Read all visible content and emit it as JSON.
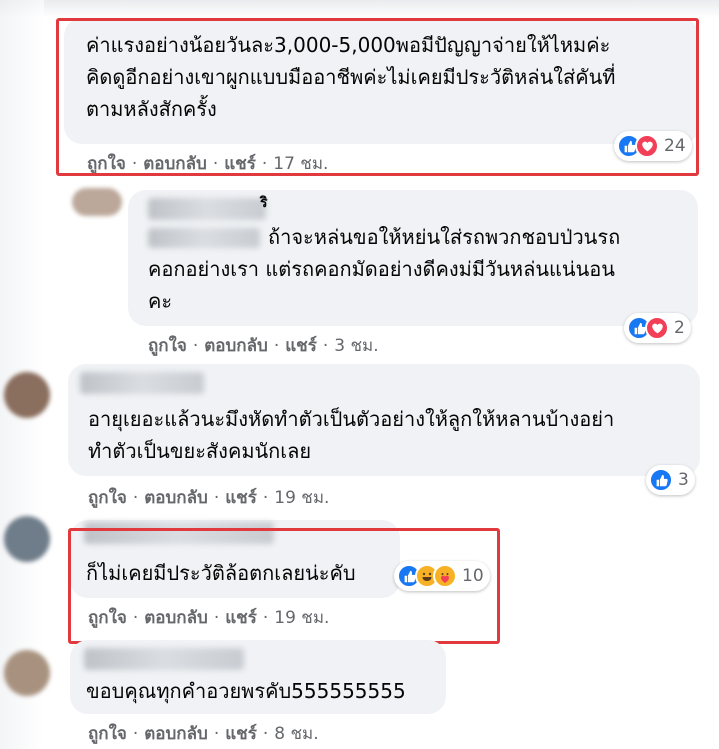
{
  "colors": {
    "bubble": "#f0f2f5",
    "text": "#050505",
    "secondary": "#65676b",
    "like": "#1877f2",
    "love": "#f33e58",
    "haha": "#f7b125",
    "highlight_box": "#e0393e"
  },
  "actions": {
    "like_label": "ถูกใจ",
    "reply_label": "ตอบกลับ",
    "share_label": "แชร์"
  },
  "comments": [
    {
      "lines": [
        "ค่าแรงอย่างน้อยวันละ3,000-5,000พอมีปัญญาจ่ายให้ไหมค่ะ",
        "คิดดูอีกอย่างเขาผูกแบบมืออาชีพค่ะไม่เคยมีประวัติหล่นใส่คันที่",
        "ตามหลังสักครั้ง"
      ],
      "time": "17 ชม.",
      "reactions": [
        "like-icon",
        "love-icon"
      ],
      "reaction_count": "24"
    },
    {
      "name_fragment": "ริ",
      "lines": [
        "ถ้าจะหล่นขอให้หย่นใส่รถพวกชอบป่วนรถ",
        "คอกอย่างเรา แต่รถคอกมัดอย่างดีคงม่มีวันหล่นแน่นอน",
        "คะ"
      ],
      "time": "3 ชม.",
      "reactions": [
        "like-icon",
        "love-icon"
      ],
      "reaction_count": "2"
    },
    {
      "lines": [
        "อายุเยอะแล้วนะมึงหัดทำตัวเป็นตัวอย่างให้ลูกให้หลานบ้างอย่า",
        "ทำตัวเป็นขยะสังคมนักเลย"
      ],
      "time": "19 ชม.",
      "reactions": [
        "like-icon"
      ],
      "reaction_count": "3"
    },
    {
      "lines": [
        "ก็ไม่เคยมีประวัติล้อตกเลยน่ะคับ"
      ],
      "time": "19 ชม.",
      "reactions": [
        "like-icon",
        "haha-icon",
        "care-icon"
      ],
      "reaction_count": "10"
    },
    {
      "lines": [
        "ขอบคุณทุกคำอวยพรคับ555555555"
      ],
      "time": "8 ชม."
    }
  ]
}
